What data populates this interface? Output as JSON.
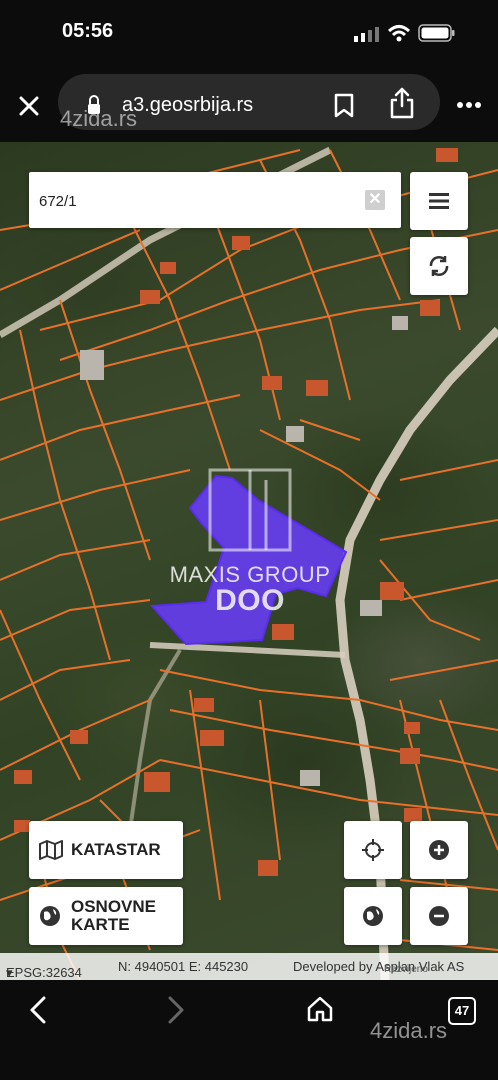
{
  "status_bar": {
    "time": "05:56"
  },
  "browser": {
    "url": "a3.geosrbija.rs",
    "tab_count": "47"
  },
  "watermarks": {
    "site": "4zida.rs",
    "brand_line1": "MAXIS GROUP",
    "brand_line2": "DOO"
  },
  "search": {
    "value": "672/1",
    "clear_glyph": "✕"
  },
  "map_controls": {
    "katastar_label": "KATASTAR",
    "basemaps_label_line1": "OSNOVNE",
    "basemaps_label_line2": "KARTE",
    "zoom_in": "+",
    "zoom_out": "−"
  },
  "footer": {
    "crs": "EPSG:32634",
    "crs_caret": "▾",
    "coords": "N: 4940501 E: 445230",
    "developer": "Developed by Asplan Vlak AS",
    "developer_sub": "Razvijeno"
  },
  "colors": {
    "parcel_line": "#e8712a",
    "selected_parcel": "#6a3cff",
    "road": "#d9cfbf"
  }
}
